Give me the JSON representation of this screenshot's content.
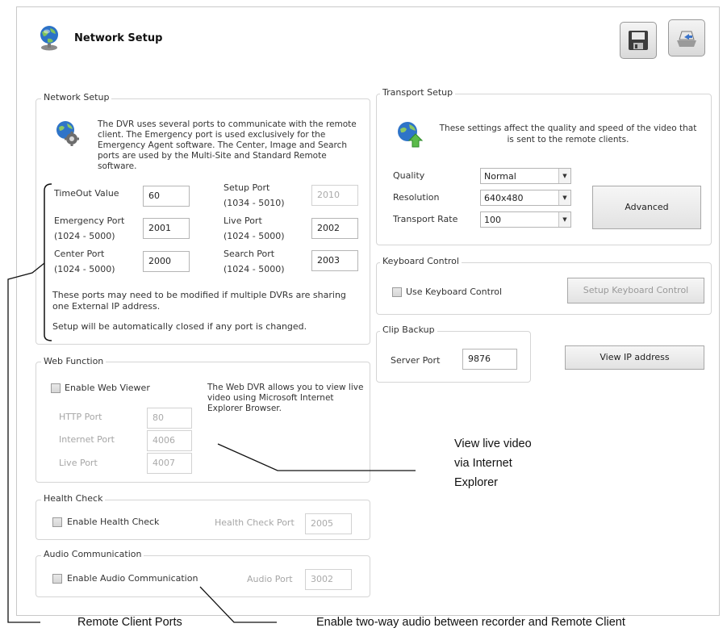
{
  "window": {
    "title": "Network Setup"
  },
  "network_setup": {
    "group_label": "Network Setup",
    "description": "The DVR uses several ports to communicate with the remote client. The Emergency port is used exclusively for the Emergency Agent software. The Center, Image and Search ports are used by the Multi-Site and Standard Remote software.",
    "timeout": {
      "label": "TimeOut Value",
      "value": "60"
    },
    "setup_port": {
      "label": "Setup Port",
      "range": "(1034 - 5010)",
      "value": "2010"
    },
    "emergency_port": {
      "label": "Emergency Port",
      "range": "(1024 - 5000)",
      "value": "2001"
    },
    "live_port": {
      "label": "Live Port",
      "range": "(1024 - 5000)",
      "value": "2002"
    },
    "center_port": {
      "label": "Center Port",
      "range": "(1024 - 5000)",
      "value": "2000"
    },
    "search_port": {
      "label": "Search Port",
      "range": "(1024 - 5000)",
      "value": "2003"
    },
    "note1": "These ports may need to be modified if multiple DVRs are sharing one External IP address.",
    "note2": "Setup will be automatically closed if any port is changed."
  },
  "web_function": {
    "group_label": "Web Function",
    "enable_label": "Enable Web Viewer",
    "enabled": false,
    "description": "The Web DVR allows you to view live video using Microsoft Internet Explorer Browser.",
    "http_port": {
      "label": "HTTP Port",
      "value": "80"
    },
    "internet_port": {
      "label": "Internet Port",
      "value": "4006"
    },
    "live_port": {
      "label": "Live Port",
      "value": "4007"
    }
  },
  "health_check": {
    "group_label": "Health Check",
    "enable_label": "Enable Health Check",
    "enabled": false,
    "port_label": "Health Check Port",
    "port_value": "2005"
  },
  "audio": {
    "group_label": "Audio Communication",
    "enable_label": "Enable Audio Communication",
    "enabled": false,
    "port_label": "Audio Port",
    "port_value": "3002"
  },
  "transport": {
    "group_label": "Transport Setup",
    "description": "These settings affect the quality and speed of the video that is sent to the remote clients.",
    "quality": {
      "label": "Quality",
      "value": "Normal"
    },
    "resolution": {
      "label": "Resolution",
      "value": "640x480"
    },
    "rate": {
      "label": "Transport Rate",
      "value": "100"
    },
    "advanced_label": "Advanced"
  },
  "keyboard": {
    "group_label": "Keyboard Control",
    "use_label": "Use Keyboard Control",
    "enabled": false,
    "setup_label": "Setup Keyboard Control"
  },
  "clip_backup": {
    "group_label": "Clip Backup",
    "server_port_label": "Server Port",
    "server_port_value": "9876",
    "view_ip_label": "View IP address"
  },
  "callouts": {
    "web": [
      "View live video",
      "via Internet",
      "Explorer"
    ],
    "ports": "Remote Client Ports",
    "audio": "Enable two-way audio between recorder and Remote Client"
  },
  "icons": {
    "title": "globe-person-icon",
    "save": "floppy-disk-icon",
    "exit": "exit-tray-icon",
    "network": "gear-globe-icon",
    "transport": "globe-arrow-icon"
  },
  "colors": {
    "group_border": "#d5d5d5",
    "disabled_text": "#a6a6a6",
    "callout_line": "#111111"
  }
}
